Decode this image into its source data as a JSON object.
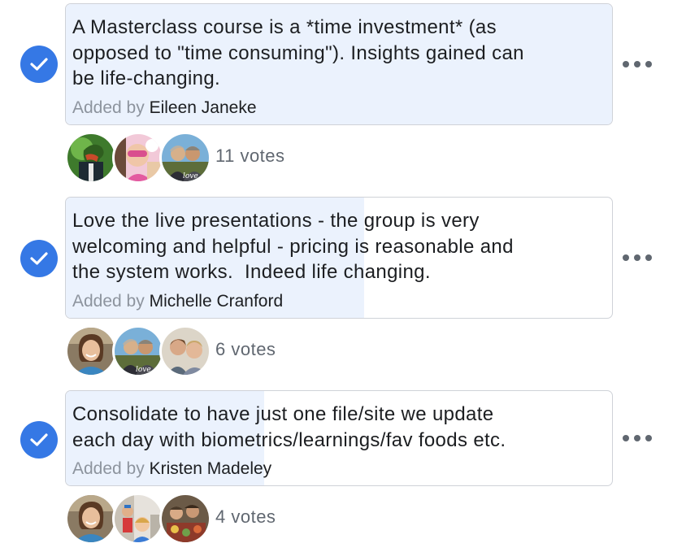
{
  "options": [
    {
      "text": "A Masterclass course is a *time investment* (as\nopposed to \"time consuming\"). Insights gained can\nbe life-changing.",
      "added_by_label": "Added by",
      "author": "Eileen Janeke",
      "votes_label": "11 votes",
      "vote_share": 11,
      "checked": true
    },
    {
      "text": "Love the live presentations - the group is very\nwelcoming and helpful - pricing is reasonable and\nthe system works.  Indeed life changing.",
      "added_by_label": "Added by",
      "author": "Michelle Cranford",
      "votes_label": "6 votes",
      "vote_share": 6,
      "checked": true
    },
    {
      "text": "Consolidate to have just one file/site we update\neach day with biometrics/learnings/fav foods etc.",
      "added_by_label": "Added by",
      "author": "Kristen Madeley",
      "votes_label": "4 votes",
      "vote_share": 4,
      "checked": true
    }
  ],
  "avatar_text": {
    "love": "love"
  },
  "icons": {
    "check": "check-icon",
    "more": "more-horizontal-icon",
    "avatar": "profile-photo"
  },
  "colors": {
    "accent": "#3578e5",
    "fill": "#ebf2fd",
    "border": "#cfd2d8",
    "muted": "#8d949e",
    "text": "#1c1e21"
  }
}
